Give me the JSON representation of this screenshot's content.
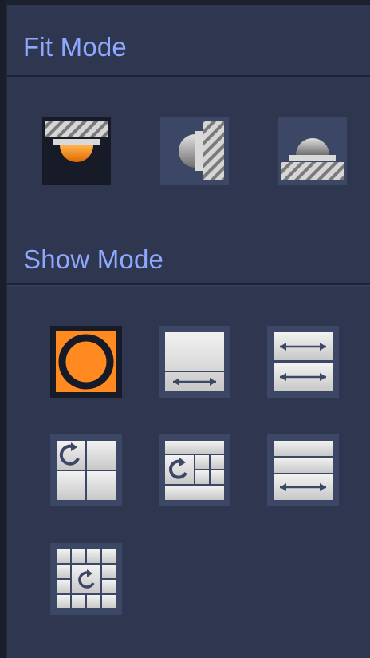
{
  "fit_mode": {
    "title": "Fit Mode",
    "options": [
      {
        "icon": "ceiling-mount-icon",
        "selected": true
      },
      {
        "icon": "wall-mount-icon",
        "selected": false
      },
      {
        "icon": "ground-mount-icon",
        "selected": false
      }
    ]
  },
  "show_mode": {
    "title": "Show Mode",
    "options": [
      {
        "icon": "fisheye-original-icon",
        "selected": true
      },
      {
        "icon": "panorama-360-icon",
        "selected": false
      },
      {
        "icon": "dual-panorama-icon",
        "selected": false
      },
      {
        "icon": "fisheye-plus-3-icon",
        "selected": false
      },
      {
        "icon": "fisheye-plus-8-icon",
        "selected": false
      },
      {
        "icon": "panorama-plus-6-icon",
        "selected": false
      },
      {
        "icon": "fisheye-plus-9-icon",
        "selected": false
      }
    ]
  },
  "colors": {
    "accent": "#ff8a1f",
    "title": "#8fa8ff",
    "panel": "#2f3650"
  }
}
